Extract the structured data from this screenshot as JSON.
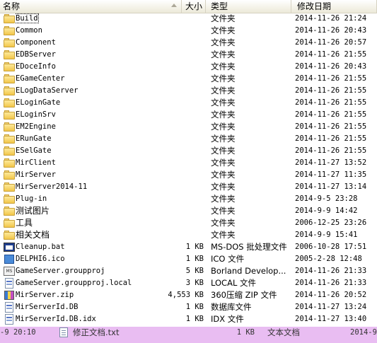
{
  "columns": {
    "name": "名称",
    "size": "大小",
    "type": "类型",
    "date": "修改日期"
  },
  "rows": [
    {
      "name": "Build",
      "size": "",
      "type": "文件夹",
      "date": "2014-11-26 21:24",
      "icon": "folder-icon"
    },
    {
      "name": "Common",
      "size": "",
      "type": "文件夹",
      "date": "2014-11-26 20:43",
      "icon": "folder-icon"
    },
    {
      "name": "Component",
      "size": "",
      "type": "文件夹",
      "date": "2014-11-26 20:57",
      "icon": "folder-icon"
    },
    {
      "name": "EDBServer",
      "size": "",
      "type": "文件夹",
      "date": "2014-11-26 21:55",
      "icon": "folder-icon"
    },
    {
      "name": "EDoceInfo",
      "size": "",
      "type": "文件夹",
      "date": "2014-11-26 20:43",
      "icon": "folder-icon"
    },
    {
      "name": "EGameCenter",
      "size": "",
      "type": "文件夹",
      "date": "2014-11-26 21:55",
      "icon": "folder-icon"
    },
    {
      "name": "ELogDataServer",
      "size": "",
      "type": "文件夹",
      "date": "2014-11-26 21:55",
      "icon": "folder-icon"
    },
    {
      "name": "ELoginGate",
      "size": "",
      "type": "文件夹",
      "date": "2014-11-26 21:55",
      "icon": "folder-icon"
    },
    {
      "name": "ELoginSrv",
      "size": "",
      "type": "文件夹",
      "date": "2014-11-26 21:55",
      "icon": "folder-icon"
    },
    {
      "name": "EM2Engine",
      "size": "",
      "type": "文件夹",
      "date": "2014-11-26 21:55",
      "icon": "folder-icon"
    },
    {
      "name": "ERunGate",
      "size": "",
      "type": "文件夹",
      "date": "2014-11-26 21:55",
      "icon": "folder-icon"
    },
    {
      "name": "ESelGate",
      "size": "",
      "type": "文件夹",
      "date": "2014-11-26 21:55",
      "icon": "folder-icon"
    },
    {
      "name": "MirClient",
      "size": "",
      "type": "文件夹",
      "date": "2014-11-27 13:52",
      "icon": "folder-icon"
    },
    {
      "name": "MirServer",
      "size": "",
      "type": "文件夹",
      "date": "2014-11-27 11:35",
      "icon": "folder-icon"
    },
    {
      "name": "MirServer2014-11",
      "size": "",
      "type": "文件夹",
      "date": "2014-11-27 13:14",
      "icon": "folder-icon"
    },
    {
      "name": "Plug-in",
      "size": "",
      "type": "文件夹",
      "date": "2014-9-5 23:28",
      "icon": "folder-icon"
    },
    {
      "name": "测试图片",
      "size": "",
      "type": "文件夹",
      "date": "2014-9-9 14:42",
      "icon": "folder-icon"
    },
    {
      "name": "工具",
      "size": "",
      "type": "文件夹",
      "date": "2006-12-25 23:26",
      "icon": "folder-icon"
    },
    {
      "name": "相关文档",
      "size": "",
      "type": "文件夹",
      "date": "2014-9-9 15:41",
      "icon": "folder-icon"
    },
    {
      "name": "Cleanup.bat",
      "size": "1 KB",
      "type": "MS-DOS 批处理文件",
      "date": "2006-10-28 17:51",
      "icon": "batch-file-icon"
    },
    {
      "name": "DELPHI6.ico",
      "size": "1 KB",
      "type": "ICO 文件",
      "date": "2005-2-28 12:48",
      "icon": "ico-file-icon"
    },
    {
      "name": "GameServer.groupproj",
      "size": "5 KB",
      "type": "Borland Develop...",
      "date": "2014-11-26 21:33",
      "icon": "ms-file-icon"
    },
    {
      "name": "GameServer.groupproj.local",
      "size": "3 KB",
      "type": "LOCAL 文件",
      "date": "2014-11-26 21:33",
      "icon": "document-icon"
    },
    {
      "name": "MirServer.zip",
      "size": "4,553 KB",
      "type": "360压缩 ZIP 文件",
      "date": "2014-11-26 20:52",
      "icon": "zip-file-icon"
    },
    {
      "name": "MirServerId.DB",
      "size": "1 KB",
      "type": "数据库文件",
      "date": "2014-11-27 13:24",
      "icon": "document-icon"
    },
    {
      "name": "MirServerId.DB.idx",
      "size": "1 KB",
      "type": "IDX 文件",
      "date": "2014-11-27 13:40",
      "icon": "document-icon"
    }
  ],
  "drag_ghost": {
    "date_left": "-9 20:10",
    "name": "修正文档.txt",
    "size": "1 KB",
    "type": "文本文档",
    "date_right": "2014-9"
  }
}
